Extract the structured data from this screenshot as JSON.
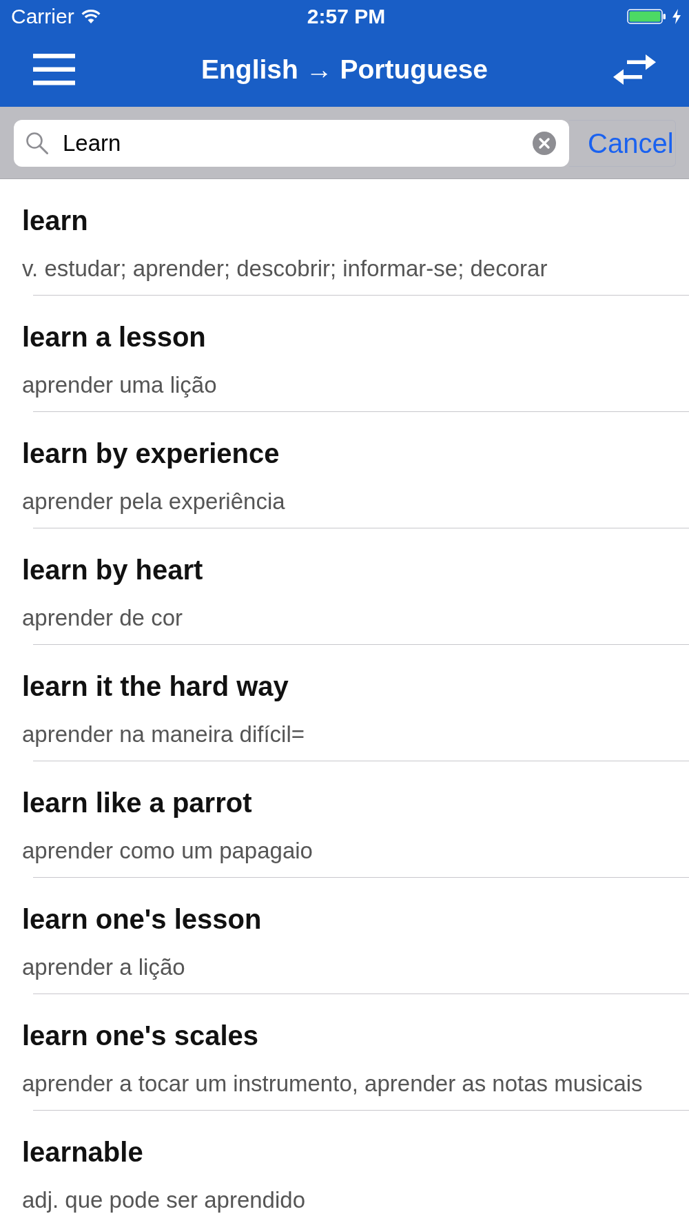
{
  "status_bar": {
    "carrier": "Carrier",
    "time": "2:57 PM"
  },
  "nav_bar": {
    "title": "English → Portuguese"
  },
  "search": {
    "value": "Learn",
    "cancel": "Cancel"
  },
  "results": [
    {
      "term": "learn",
      "translation": "v. estudar; aprender; descobrir; informar-se; decorar"
    },
    {
      "term": "learn a lesson",
      "translation": "aprender uma lição"
    },
    {
      "term": "learn by experience",
      "translation": "aprender pela experiência"
    },
    {
      "term": "learn by heart",
      "translation": "aprender de cor"
    },
    {
      "term": "learn it the hard way",
      "translation": "aprender na maneira difícil="
    },
    {
      "term": "learn like a parrot",
      "translation": "aprender como um papagaio"
    },
    {
      "term": "learn one's lesson",
      "translation": "aprender a lição"
    },
    {
      "term": "learn one's scales",
      "translation": "aprender a tocar um instrumento, aprender as notas musicais"
    },
    {
      "term": "learnable",
      "translation": "adj. que pode ser aprendido"
    }
  ]
}
